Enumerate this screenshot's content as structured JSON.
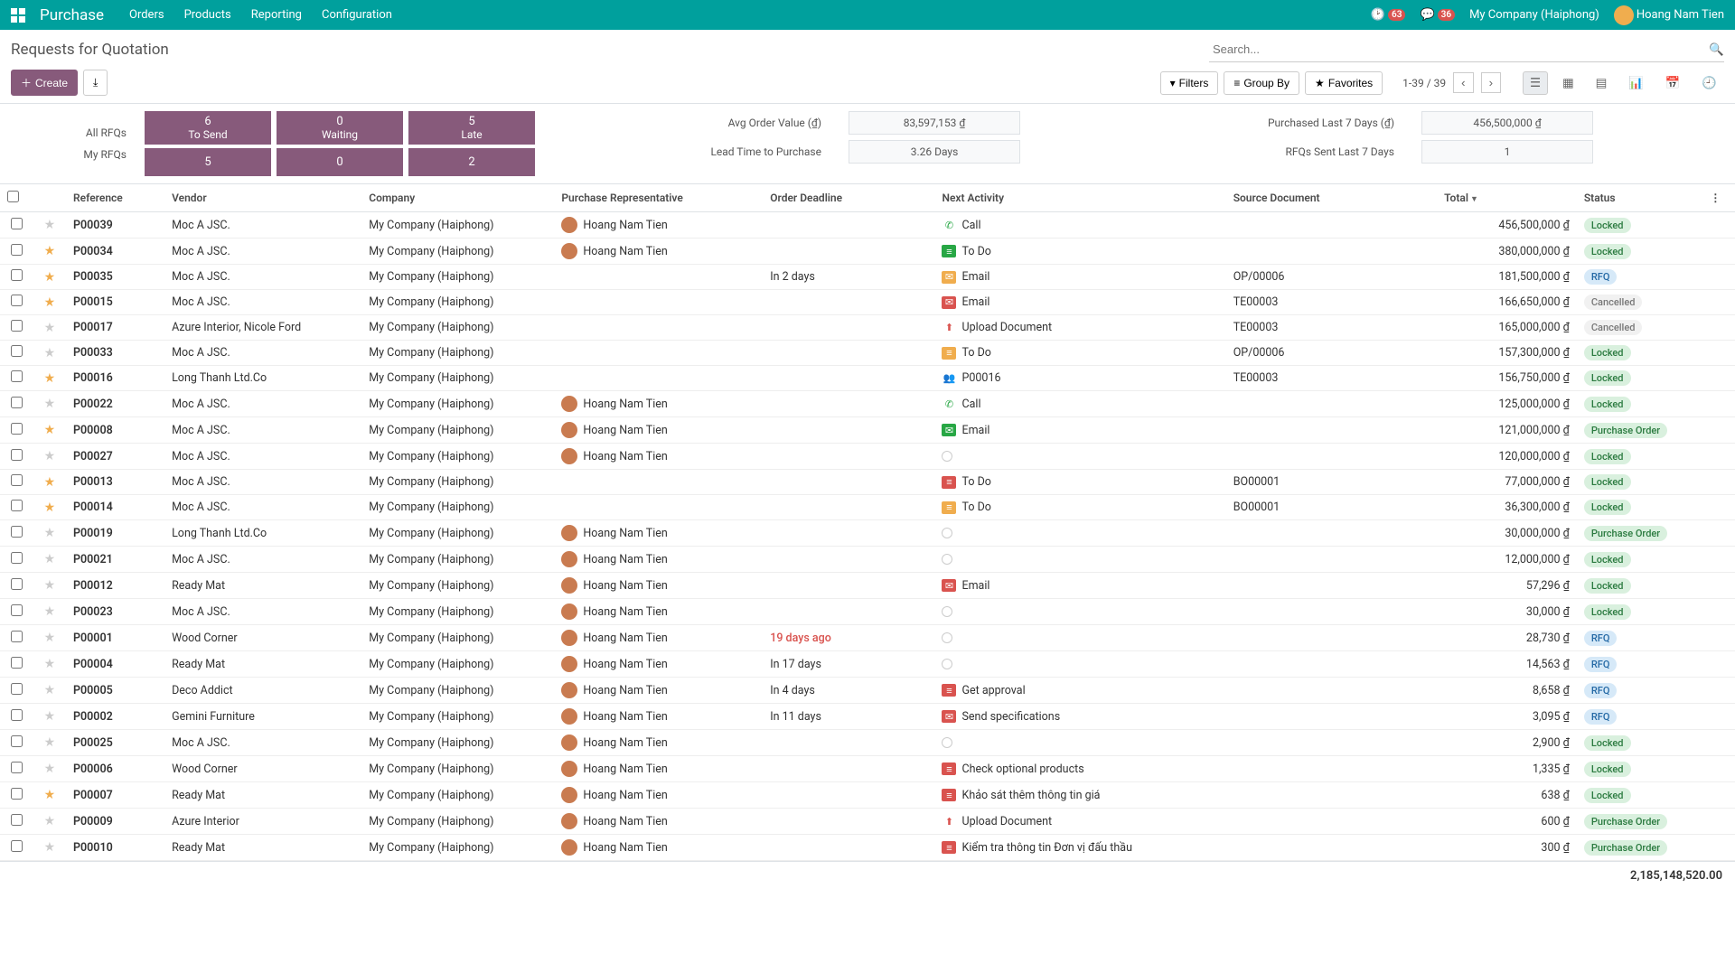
{
  "topbar": {
    "brand": "Purchase",
    "nav": [
      "Orders",
      "Products",
      "Reporting",
      "Configuration"
    ],
    "clock_badge": "63",
    "chat_badge": "36",
    "company": "My Company (Haiphong)",
    "user": "Hoang Nam Tien"
  },
  "page_title": "Requests for Quotation",
  "search": {
    "placeholder": "Search..."
  },
  "toolbar": {
    "create": "Create",
    "filters": "Filters",
    "group_by": "Group By",
    "favorites": "Favorites",
    "pager": "1-39 / 39"
  },
  "dashboard": {
    "row_labels": [
      "All RFQs",
      "My RFQs"
    ],
    "cols": [
      {
        "label": "To Send",
        "all": "6",
        "mine": "5"
      },
      {
        "label": "Waiting",
        "all": "0",
        "mine": "0"
      },
      {
        "label": "Late",
        "all": "5",
        "mine": "2"
      }
    ],
    "stats": [
      {
        "label": "Avg Order Value (₫)",
        "value": "83,597,153 ₫"
      },
      {
        "label": "Lead Time to Purchase",
        "value": "3.26  Days"
      },
      {
        "label": "Purchased Last 7 Days (₫)",
        "value": "456,500,000 ₫"
      },
      {
        "label": "RFQs Sent Last 7 Days",
        "value": "1"
      }
    ]
  },
  "columns": {
    "reference": "Reference",
    "vendor": "Vendor",
    "company": "Company",
    "rep": "Purchase Representative",
    "deadline": "Order Deadline",
    "activity": "Next Activity",
    "source": "Source Document",
    "total": "Total",
    "status": "Status"
  },
  "rows": [
    {
      "star": false,
      "ref": "P00039",
      "vendor": "Moc A JSC.",
      "company": "My Company (Haiphong)",
      "rep": "Hoang Nam Tien",
      "deadline": "",
      "overdue": false,
      "act_icon": "call",
      "activity": "Call",
      "source": "",
      "total": "456,500,000 ₫",
      "status": "Locked",
      "status_cls": "st-locked"
    },
    {
      "star": true,
      "ref": "P00034",
      "vendor": "Moc A JSC.",
      "company": "My Company (Haiphong)",
      "rep": "Hoang Nam Tien",
      "deadline": "",
      "overdue": false,
      "act_icon": "todo",
      "activity": "To Do",
      "source": "",
      "total": "380,000,000 ₫",
      "status": "Locked",
      "status_cls": "st-locked"
    },
    {
      "star": true,
      "ref": "P00035",
      "vendor": "Moc A JSC.",
      "company": "My Company (Haiphong)",
      "rep": "",
      "deadline": "In 2 days",
      "overdue": false,
      "act_icon": "email-y",
      "activity": "Email",
      "source": "OP/00006",
      "total": "181,500,000 ₫",
      "status": "RFQ",
      "status_cls": "st-rfq"
    },
    {
      "star": true,
      "ref": "P00015",
      "vendor": "Moc A JSC.",
      "company": "My Company (Haiphong)",
      "rep": "",
      "deadline": "",
      "overdue": false,
      "act_icon": "email-r",
      "activity": "Email",
      "source": "TE00003",
      "total": "166,650,000 ₫",
      "status": "Cancelled",
      "status_cls": "st-cancelled"
    },
    {
      "star": false,
      "ref": "P00017",
      "vendor": "Azure Interior, Nicole Ford",
      "company": "My Company (Haiphong)",
      "rep": "",
      "deadline": "",
      "overdue": false,
      "act_icon": "upload",
      "activity": "Upload Document",
      "source": "TE00003",
      "total": "165,000,000 ₫",
      "status": "Cancelled",
      "status_cls": "st-cancelled"
    },
    {
      "star": false,
      "ref": "P00033",
      "vendor": "Moc A JSC.",
      "company": "My Company (Haiphong)",
      "rep": "",
      "deadline": "",
      "overdue": false,
      "act_icon": "todo-y",
      "activity": "To Do",
      "source": "OP/00006",
      "total": "157,300,000 ₫",
      "status": "Locked",
      "status_cls": "st-locked"
    },
    {
      "star": true,
      "ref": "P00016",
      "vendor": "Long Thanh Ltd.Co",
      "company": "My Company (Haiphong)",
      "rep": "",
      "deadline": "",
      "overdue": false,
      "act_icon": "meeting",
      "activity": "P00016",
      "source": "TE00003",
      "total": "156,750,000 ₫",
      "status": "Locked",
      "status_cls": "st-locked"
    },
    {
      "star": false,
      "ref": "P00022",
      "vendor": "Moc A JSC.",
      "company": "My Company (Haiphong)",
      "rep": "Hoang Nam Tien",
      "deadline": "",
      "overdue": false,
      "act_icon": "call",
      "activity": "Call",
      "source": "",
      "total": "125,000,000 ₫",
      "status": "Locked",
      "status_cls": "st-locked"
    },
    {
      "star": true,
      "ref": "P00008",
      "vendor": "Moc A JSC.",
      "company": "My Company (Haiphong)",
      "rep": "Hoang Nam Tien",
      "deadline": "",
      "overdue": false,
      "act_icon": "email-g",
      "activity": "Email",
      "source": "",
      "total": "121,000,000 ₫",
      "status": "Purchase Order",
      "status_cls": "st-po"
    },
    {
      "star": false,
      "ref": "P00027",
      "vendor": "Moc A JSC.",
      "company": "My Company (Haiphong)",
      "rep": "Hoang Nam Tien",
      "deadline": "",
      "overdue": false,
      "act_icon": "none",
      "activity": "",
      "source": "",
      "total": "120,000,000 ₫",
      "status": "Locked",
      "status_cls": "st-locked"
    },
    {
      "star": true,
      "ref": "P00013",
      "vendor": "Moc A JSC.",
      "company": "My Company (Haiphong)",
      "rep": "",
      "deadline": "",
      "overdue": false,
      "act_icon": "todo-r",
      "activity": "To Do",
      "source": "BO00001",
      "total": "77,000,000 ₫",
      "status": "Locked",
      "status_cls": "st-locked"
    },
    {
      "star": true,
      "ref": "P00014",
      "vendor": "Moc A JSC.",
      "company": "My Company (Haiphong)",
      "rep": "",
      "deadline": "",
      "overdue": false,
      "act_icon": "todo-y",
      "activity": "To Do",
      "source": "BO00001",
      "total": "36,300,000 ₫",
      "status": "Locked",
      "status_cls": "st-locked"
    },
    {
      "star": false,
      "ref": "P00019",
      "vendor": "Long Thanh Ltd.Co",
      "company": "My Company (Haiphong)",
      "rep": "Hoang Nam Tien",
      "deadline": "",
      "overdue": false,
      "act_icon": "none",
      "activity": "",
      "source": "",
      "total": "30,000,000 ₫",
      "status": "Purchase Order",
      "status_cls": "st-po"
    },
    {
      "star": false,
      "ref": "P00021",
      "vendor": "Moc A JSC.",
      "company": "My Company (Haiphong)",
      "rep": "Hoang Nam Tien",
      "deadline": "",
      "overdue": false,
      "act_icon": "none",
      "activity": "",
      "source": "",
      "total": "12,000,000 ₫",
      "status": "Locked",
      "status_cls": "st-locked"
    },
    {
      "star": false,
      "ref": "P00012",
      "vendor": "Ready Mat",
      "company": "My Company (Haiphong)",
      "rep": "Hoang Nam Tien",
      "deadline": "",
      "overdue": false,
      "act_icon": "email-r",
      "activity": "Email",
      "source": "",
      "total": "57,296 ₫",
      "status": "Locked",
      "status_cls": "st-locked"
    },
    {
      "star": false,
      "ref": "P00023",
      "vendor": "Moc A JSC.",
      "company": "My Company (Haiphong)",
      "rep": "Hoang Nam Tien",
      "deadline": "",
      "overdue": false,
      "act_icon": "none",
      "activity": "",
      "source": "",
      "total": "30,000 ₫",
      "status": "Locked",
      "status_cls": "st-locked"
    },
    {
      "star": false,
      "ref": "P00001",
      "vendor": "Wood Corner",
      "company": "My Company (Haiphong)",
      "rep": "Hoang Nam Tien",
      "deadline": "19 days ago",
      "overdue": true,
      "act_icon": "none",
      "activity": "",
      "source": "",
      "total": "28,730 ₫",
      "status": "RFQ",
      "status_cls": "st-rfq"
    },
    {
      "star": false,
      "ref": "P00004",
      "vendor": "Ready Mat",
      "company": "My Company (Haiphong)",
      "rep": "Hoang Nam Tien",
      "deadline": "In 17 days",
      "overdue": false,
      "act_icon": "none",
      "activity": "",
      "source": "",
      "total": "14,563 ₫",
      "status": "RFQ",
      "status_cls": "st-rfq"
    },
    {
      "star": false,
      "ref": "P00005",
      "vendor": "Deco Addict",
      "company": "My Company (Haiphong)",
      "rep": "Hoang Nam Tien",
      "deadline": "In 4 days",
      "overdue": false,
      "act_icon": "todo-r",
      "activity": "Get approval",
      "source": "",
      "total": "8,658 ₫",
      "status": "RFQ",
      "status_cls": "st-rfq"
    },
    {
      "star": false,
      "ref": "P00002",
      "vendor": "Gemini Furniture",
      "company": "My Company (Haiphong)",
      "rep": "Hoang Nam Tien",
      "deadline": "In 11 days",
      "overdue": false,
      "act_icon": "email-r",
      "activity": "Send specifications",
      "source": "",
      "total": "3,095 ₫",
      "status": "RFQ",
      "status_cls": "st-rfq"
    },
    {
      "star": false,
      "ref": "P00025",
      "vendor": "Moc A JSC.",
      "company": "My Company (Haiphong)",
      "rep": "Hoang Nam Tien",
      "deadline": "",
      "overdue": false,
      "act_icon": "none",
      "activity": "",
      "source": "",
      "total": "2,900 ₫",
      "status": "Locked",
      "status_cls": "st-locked"
    },
    {
      "star": false,
      "ref": "P00006",
      "vendor": "Wood Corner",
      "company": "My Company (Haiphong)",
      "rep": "Hoang Nam Tien",
      "deadline": "",
      "overdue": false,
      "act_icon": "todo-r",
      "activity": "Check optional products",
      "source": "",
      "total": "1,335 ₫",
      "status": "Locked",
      "status_cls": "st-locked"
    },
    {
      "star": true,
      "ref": "P00007",
      "vendor": "Ready Mat",
      "company": "My Company (Haiphong)",
      "rep": "Hoang Nam Tien",
      "deadline": "",
      "overdue": false,
      "act_icon": "todo-r",
      "activity": "Khảo sát thêm thông tin giá",
      "source": "",
      "total": "638 ₫",
      "status": "Locked",
      "status_cls": "st-locked"
    },
    {
      "star": false,
      "ref": "P00009",
      "vendor": "Azure Interior",
      "company": "My Company (Haiphong)",
      "rep": "Hoang Nam Tien",
      "deadline": "",
      "overdue": false,
      "act_icon": "upload",
      "activity": "Upload Document",
      "source": "",
      "total": "600 ₫",
      "status": "Purchase Order",
      "status_cls": "st-po"
    },
    {
      "star": false,
      "ref": "P00010",
      "vendor": "Ready Mat",
      "company": "My Company (Haiphong)",
      "rep": "Hoang Nam Tien",
      "deadline": "",
      "overdue": false,
      "act_icon": "todo-r",
      "activity": "Kiểm tra thông tin Đơn vị đấu thầu",
      "source": "",
      "total": "300 ₫",
      "status": "Purchase Order",
      "status_cls": "st-po"
    }
  ],
  "footer_total": "2,185,148,520.00"
}
